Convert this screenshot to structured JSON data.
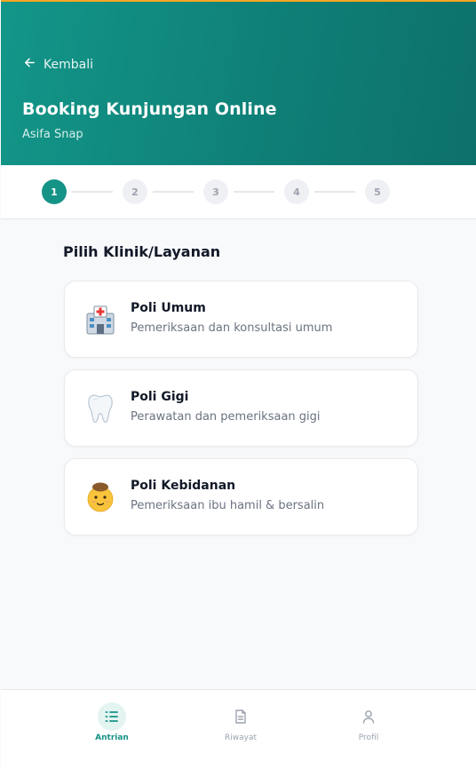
{
  "header": {
    "back_label": "Kembali",
    "title": "Booking Kunjungan Online",
    "subtitle": "Asifa Snap"
  },
  "stepper": {
    "steps": [
      "1",
      "2",
      "3",
      "4",
      "5"
    ],
    "current_step": 1
  },
  "section_title": "Pilih Klinik/Layanan",
  "services": [
    {
      "name": "Poli Umum",
      "description": "Pemeriksaan dan konsultasi umum",
      "icon": "hospital-icon"
    },
    {
      "name": "Poli Gigi",
      "description": "Perawatan dan pemeriksaan gigi",
      "icon": "tooth-icon"
    },
    {
      "name": "Poli Kebidanan",
      "description": "Pemeriksaan ibu hamil & bersalin",
      "icon": "baby-icon"
    }
  ],
  "bottom_nav": [
    {
      "label": "Antrian",
      "icon": "queue-list-icon",
      "active": true
    },
    {
      "label": "Riwayat",
      "icon": "document-icon",
      "active": false
    },
    {
      "label": "Profil",
      "icon": "user-icon",
      "active": false
    }
  ],
  "colors": {
    "primary": "#159386",
    "header_start": "#139689",
    "header_end": "#0d716a",
    "top_accent": "#f5a623"
  }
}
